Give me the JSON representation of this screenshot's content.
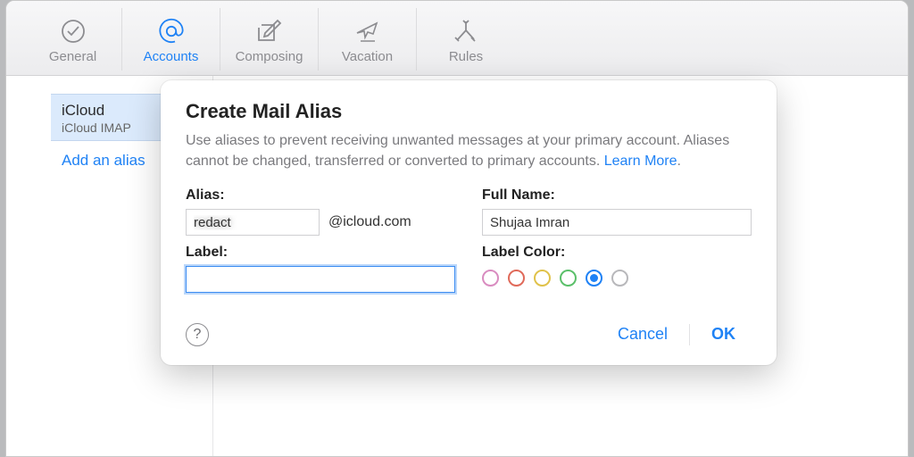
{
  "toolbar": {
    "tabs": [
      {
        "id": "general",
        "label": "General"
      },
      {
        "id": "accounts",
        "label": "Accounts"
      },
      {
        "id": "composing",
        "label": "Composing"
      },
      {
        "id": "vacation",
        "label": "Vacation"
      },
      {
        "id": "rules",
        "label": "Rules"
      }
    ],
    "active": "accounts"
  },
  "sidebar": {
    "account_name": "iCloud",
    "account_sub": "iCloud IMAP",
    "add_alias_label": "Add an alias"
  },
  "dialog": {
    "title": "Create Mail Alias",
    "description_pre": "Use aliases to prevent receiving unwanted messages at your primary account. Aliases cannot be changed, transferred or converted to primary accounts. ",
    "learn_more": "Learn More",
    "description_post": ".",
    "fields": {
      "alias_label": "Alias:",
      "alias_value": "redact",
      "alias_domain": "@icloud.com",
      "fullname_label": "Full Name:",
      "fullname_value": "Shujaa Imran",
      "label_label": "Label:",
      "label_value": "",
      "color_label": "Label Color:"
    },
    "colors": [
      {
        "name": "pink",
        "hex": "#d98cc0"
      },
      {
        "name": "red",
        "hex": "#e06a5a"
      },
      {
        "name": "yellow",
        "hex": "#e0c24a"
      },
      {
        "name": "green",
        "hex": "#5bc06a"
      },
      {
        "name": "blue",
        "hex": "#1f82f5"
      },
      {
        "name": "none",
        "hex": "#b8b8bb"
      }
    ],
    "selected_color": "blue",
    "help_glyph": "?",
    "cancel_label": "Cancel",
    "ok_label": "OK"
  }
}
